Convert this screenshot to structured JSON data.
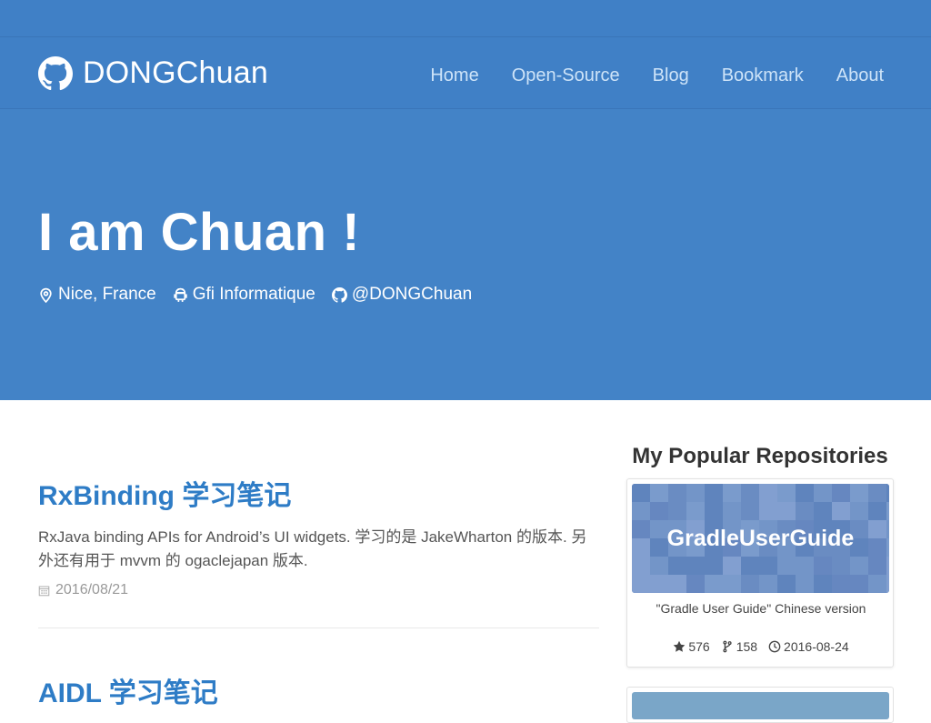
{
  "header": {
    "brand": "DONGChuan",
    "nav": [
      {
        "label": "Home"
      },
      {
        "label": "Open-Source"
      },
      {
        "label": "Blog"
      },
      {
        "label": "Bookmark"
      },
      {
        "label": "About"
      }
    ]
  },
  "hero": {
    "title": "I am Chuan !",
    "location": "Nice, France",
    "company": "Gfi Informatique",
    "github": "@DONGChuan"
  },
  "posts": [
    {
      "title": "RxBinding 学习笔记",
      "summary": "RxJava binding APIs for Android’s UI widgets. 学习的是 JakeWharton 的版本. 另外还有用于 mvvm 的 ogaclejapan 版本.",
      "date": "2016/08/21"
    },
    {
      "title": "AIDL 学习笔记"
    }
  ],
  "sidebar": {
    "title": "My Popular Repositories",
    "repos": [
      {
        "name": "GradleUserGuide",
        "description": "\"Gradle User Guide\" Chinese version",
        "stars": "576",
        "forks": "158",
        "updated": "2016-08-24"
      }
    ]
  },
  "colors": {
    "primary": "#4080c6",
    "hero": "#4383c7",
    "link": "#2e7cc6",
    "nav_link": "#cde3f8"
  },
  "icons": [
    "github-icon",
    "location-pin-icon",
    "android-icon",
    "calendar-icon",
    "star-icon",
    "fork-icon",
    "clock-icon"
  ]
}
